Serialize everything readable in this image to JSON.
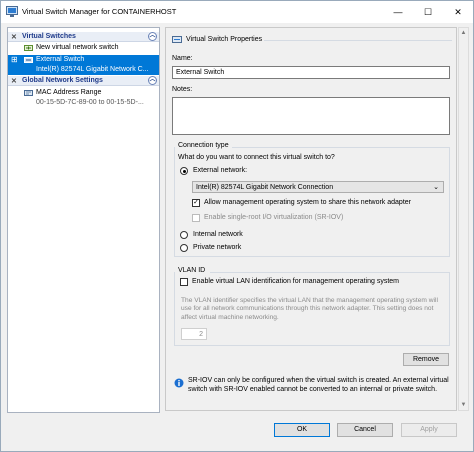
{
  "window": {
    "title": "Virtual Switch Manager for CONTAINERHOST",
    "minimize": "—",
    "maximize": "☐",
    "close": "✕"
  },
  "left_pane": {
    "virtual_switches_header": "Virtual Switches",
    "items": [
      {
        "label": "New virtual network switch"
      },
      {
        "label": "External Switch",
        "sub": "Intel(R) 82574L Gigabit Network C..."
      }
    ],
    "global_header": "Global Network Settings",
    "mac_range": {
      "label": "MAC Address Range",
      "sub": "00-15-5D-7C-89-00 to 00-15-5D-..."
    }
  },
  "properties": {
    "header": "Virtual Switch Properties",
    "name_label": "Name:",
    "name_value": "External Switch",
    "notes_label": "Notes:",
    "notes_value": "",
    "connection_type": {
      "label": "Connection type",
      "question": "What do you want to connect this virtual switch to?",
      "external_label": "External network:",
      "adapter_selected": "Intel(R) 82574L Gigabit Network Connection",
      "allow_mgmt": "Allow management operating system to share this network adapter",
      "enable_sriov": "Enable single-root I/O virtualization (SR-IOV)",
      "internal_label": "Internal network",
      "private_label": "Private network"
    },
    "vlan": {
      "label": "VLAN ID",
      "enable": "Enable virtual LAN identification for management operating system",
      "description": "The VLAN identifier specifies the virtual LAN that the management operating system will use for all network communications through this network adapter. This setting does not affect virtual machine networking.",
      "value": "2"
    },
    "remove_label": "Remove",
    "info_text": "SR-IOV can only be configured when the virtual switch is created. An external virtual switch with SR-IOV enabled cannot be converted to an internal or private switch."
  },
  "footer": {
    "ok": "OK",
    "cancel": "Cancel",
    "apply": "Apply"
  }
}
